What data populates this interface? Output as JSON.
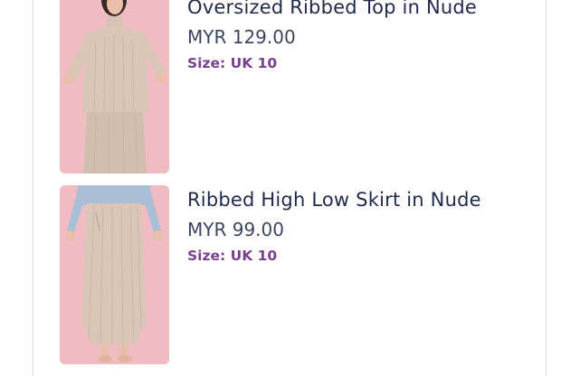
{
  "cart": {
    "items": [
      {
        "name": "Oversized Ribbed Top in Nude",
        "price": "MYR 129.00",
        "size": "Size: UK 10",
        "image_icon": "product-photo-top"
      },
      {
        "name": "Ribbed High Low Skirt in Nude",
        "price": "MYR 99.00",
        "size": "Size: UK 10",
        "image_icon": "product-photo-skirt"
      }
    ]
  },
  "colors": {
    "title": "#1f2a4a",
    "price": "#3b4560",
    "size": "#7a3f8e",
    "photo_background": "#f0bcc2",
    "garment": "#d9c6b6"
  }
}
